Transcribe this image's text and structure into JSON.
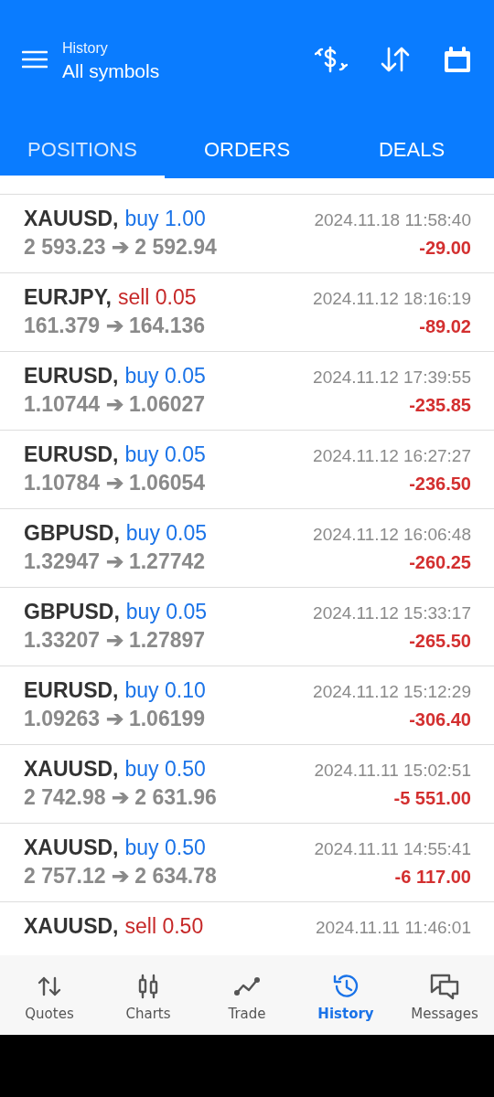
{
  "header": {
    "subtitle": "History",
    "title": "All symbols"
  },
  "tabs": [
    {
      "label": "POSITIONS",
      "selected": true
    },
    {
      "label": "ORDERS",
      "selected": false
    },
    {
      "label": "DEALS",
      "selected": false
    }
  ],
  "positions": [
    {
      "symbol": "XAUUSD,",
      "kind": "buy",
      "order": "buy 1.00",
      "time": "2024.11.18 11:58:40",
      "prices": "2 593.23 ➔ 2 592.94",
      "profit": "-29.00"
    },
    {
      "symbol": "EURJPY,",
      "kind": "sell",
      "order": "sell 0.05",
      "time": "2024.11.12 18:16:19",
      "prices": "161.379 ➔ 164.136",
      "profit": "-89.02"
    },
    {
      "symbol": "EURUSD,",
      "kind": "buy",
      "order": "buy 0.05",
      "time": "2024.11.12 17:39:55",
      "prices": "1.10744 ➔ 1.06027",
      "profit": "-235.85"
    },
    {
      "symbol": "EURUSD,",
      "kind": "buy",
      "order": "buy 0.05",
      "time": "2024.11.12 16:27:27",
      "prices": "1.10784 ➔ 1.06054",
      "profit": "-236.50"
    },
    {
      "symbol": "GBPUSD,",
      "kind": "buy",
      "order": "buy 0.05",
      "time": "2024.11.12 16:06:48",
      "prices": "1.32947 ➔ 1.27742",
      "profit": "-260.25"
    },
    {
      "symbol": "GBPUSD,",
      "kind": "buy",
      "order": "buy 0.05",
      "time": "2024.11.12 15:33:17",
      "prices": "1.33207 ➔ 1.27897",
      "profit": "-265.50"
    },
    {
      "symbol": "EURUSD,",
      "kind": "buy",
      "order": "buy 0.10",
      "time": "2024.11.12 15:12:29",
      "prices": "1.09263 ➔ 1.06199",
      "profit": "-306.40"
    },
    {
      "symbol": "XAUUSD,",
      "kind": "buy",
      "order": "buy 0.50",
      "time": "2024.11.11 15:02:51",
      "prices": "2 742.98 ➔ 2 631.96",
      "profit": "-5 551.00"
    },
    {
      "symbol": "XAUUSD,",
      "kind": "buy",
      "order": "buy 0.50",
      "time": "2024.11.11 14:55:41",
      "prices": "2 757.12 ➔ 2 634.78",
      "profit": "-6 117.00"
    },
    {
      "symbol": "XAUUSD,",
      "kind": "sell",
      "order": "sell 0.50",
      "time": "2024.11.11 11:46:01"
    }
  ],
  "nav": [
    {
      "kind": "quotes",
      "label": "Quotes",
      "selected": false
    },
    {
      "kind": "charts",
      "label": "Charts",
      "selected": false
    },
    {
      "kind": "trade",
      "label": "Trade",
      "selected": false
    },
    {
      "kind": "history",
      "label": "History",
      "selected": true
    },
    {
      "kind": "messages",
      "label": "Messages",
      "selected": false
    }
  ]
}
